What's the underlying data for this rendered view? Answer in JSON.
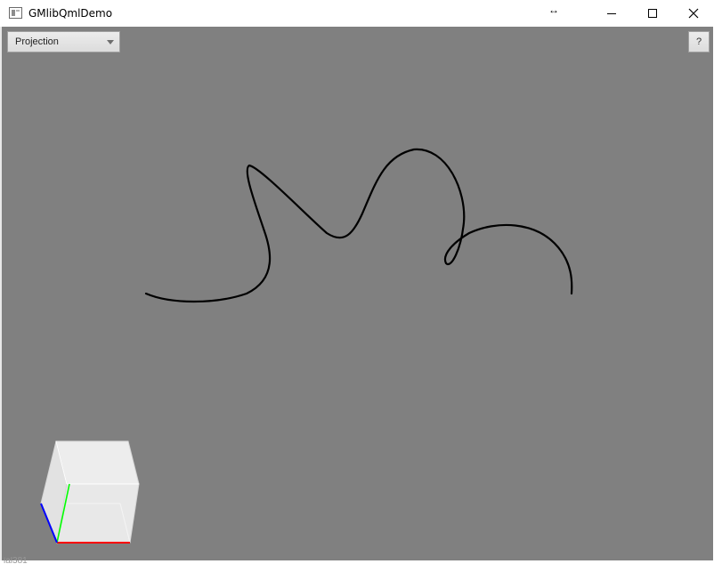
{
  "window": {
    "title": "GMlibQmlDemo",
    "resize_indicator": "↔"
  },
  "toolbar": {
    "projection_label": "Projection",
    "help_label": "?"
  },
  "colors": {
    "viewport_background": "#808080",
    "curve": "#000000",
    "axis_x": "#ff0000",
    "axis_y": "#00ff00",
    "axis_z": "#0000ff"
  },
  "footer": {
    "text": "ial381"
  }
}
